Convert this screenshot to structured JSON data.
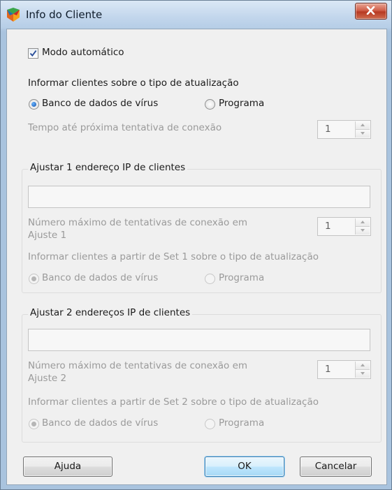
{
  "window": {
    "title": "Info do Cliente",
    "icon": "avg-logo-icon"
  },
  "auto_mode": {
    "label": "Modo automático",
    "checked": true
  },
  "update_type": {
    "heading": "Informar clientes sobre o tipo de atualização",
    "options": [
      "Banco de dados de vírus",
      "Programa"
    ],
    "selected": "Banco de dados de vírus"
  },
  "retry_time": {
    "label": "Tempo até próxima tentativa de conexão",
    "value": "1"
  },
  "group1": {
    "legend": "Ajustar 1 endereço IP de clientes",
    "ip_value": "",
    "max_attempts_label": "Número máximo de tentativas de conexão em Ajuste 1",
    "max_attempts_line1": "Número máximo de tentativas de conexão em",
    "max_attempts_line2": "Ajuste 1",
    "max_attempts_value": "1",
    "inform_label": "Informar clientes a partir de Set 1 sobre o tipo de atualização",
    "options": [
      "Banco de dados de vírus",
      "Programa"
    ],
    "selected": "Banco de dados de vírus"
  },
  "group2": {
    "legend": "Ajustar 2 endereços IP de clientes",
    "ip_value": "",
    "max_attempts_line1": "Número máximo de tentativas de conexão em",
    "max_attempts_line2": "Ajuste 2",
    "max_attempts_value": "1",
    "inform_label": "Informar clientes a partir de Set 2 sobre o tipo de atualização",
    "options": [
      "Banco de dados de vírus",
      "Programa"
    ],
    "selected": "Banco de dados de vírus"
  },
  "buttons": {
    "help": "Ajuda",
    "ok": "OK",
    "cancel": "Cancelar"
  },
  "colors": {
    "title_bar": "#c2d6ec",
    "close_button": "#c9533c",
    "default_button": "#bee6fd",
    "disabled_text": "#9a9a9a"
  }
}
